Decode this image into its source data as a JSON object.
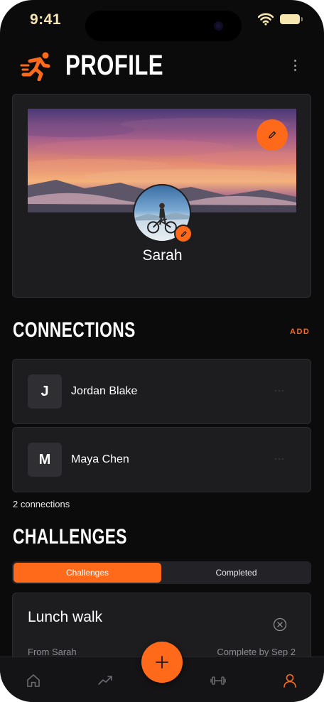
{
  "status_bar": {
    "time": "9:41"
  },
  "header": {
    "title": "PROFILE",
    "logo_icon": "runner-logo-icon",
    "menu_icon": "kebab-menu-icon"
  },
  "profile": {
    "name": "Sarah",
    "cover_edit_icon": "pencil-icon",
    "avatar_edit_icon": "pencil-icon"
  },
  "connections": {
    "title": "CONNECTIONS",
    "add_label": "ADD",
    "items": [
      {
        "initial": "J",
        "name": "Jordan Blake",
        "more": "···"
      },
      {
        "initial": "M",
        "name": "Maya Chen",
        "more": "···"
      }
    ],
    "count_label": "2 connections"
  },
  "challenges": {
    "title": "CHALLENGES",
    "tabs": [
      {
        "label": "Challenges",
        "active": true
      },
      {
        "label": "Completed",
        "active": false
      }
    ],
    "items": [
      {
        "title": "Lunch walk",
        "from": "From Sarah",
        "due": "Complete by Sep 2"
      }
    ]
  },
  "bottom_nav": {
    "items": [
      {
        "icon": "home-icon",
        "active": false
      },
      {
        "icon": "trending-icon",
        "active": false
      },
      {
        "icon": "dumbbell-icon",
        "active": false
      },
      {
        "icon": "user-icon",
        "active": true
      }
    ],
    "fab_icon": "plus-icon"
  },
  "colors": {
    "accent": "#ff6a1a",
    "background": "#0b0b0c",
    "card": "#1d1d20",
    "status": "#f7e6b0"
  }
}
